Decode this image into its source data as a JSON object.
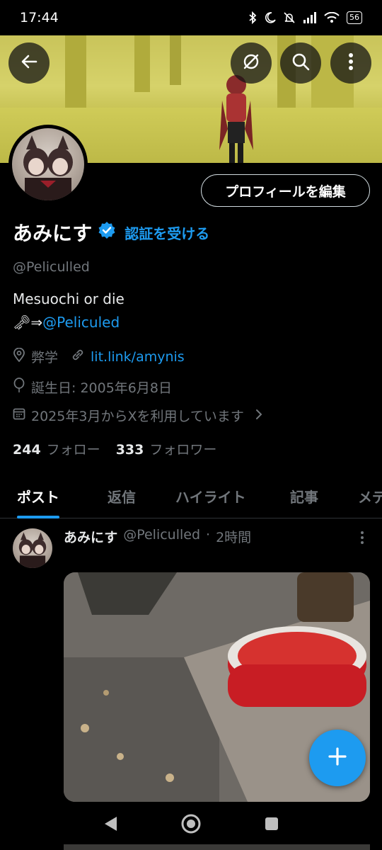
{
  "status_bar": {
    "time": "17:44",
    "battery": "56"
  },
  "header": {
    "back_icon": "arrow-left-icon",
    "buttons": [
      "no-filter-icon",
      "search-icon",
      "more-vertical-icon"
    ]
  },
  "profile": {
    "edit_button_label": "プロフィールを編集",
    "display_name": "あみにす",
    "verify_link": "認証を受ける",
    "handle": "@Peliculled",
    "bio_line1": "Mesuochi or die",
    "bio_line2_prefix": "🗝⇒",
    "bio_line2_mention": "@Peliculed",
    "location": "弊学",
    "website": "lit.link/amynis",
    "birthday": "誕生日: 2005年6月8日",
    "joined": "2025年3月からXを利用しています",
    "following_count": "244",
    "following_label": "フォロー",
    "followers_count": "333",
    "followers_label": "フォロワー"
  },
  "tabs": [
    {
      "label": "ポスト",
      "active": true
    },
    {
      "label": "返信",
      "active": false
    },
    {
      "label": "ハイライト",
      "active": false
    },
    {
      "label": "記事",
      "active": false
    },
    {
      "label": "メデ",
      "active": false
    }
  ],
  "post": {
    "author_name": "あみにす",
    "author_handle": "@Peliculled",
    "separator": "·",
    "time": "2時間"
  },
  "colors": {
    "accent": "#1d9bf0",
    "background": "#000000",
    "muted": "#71767b"
  }
}
